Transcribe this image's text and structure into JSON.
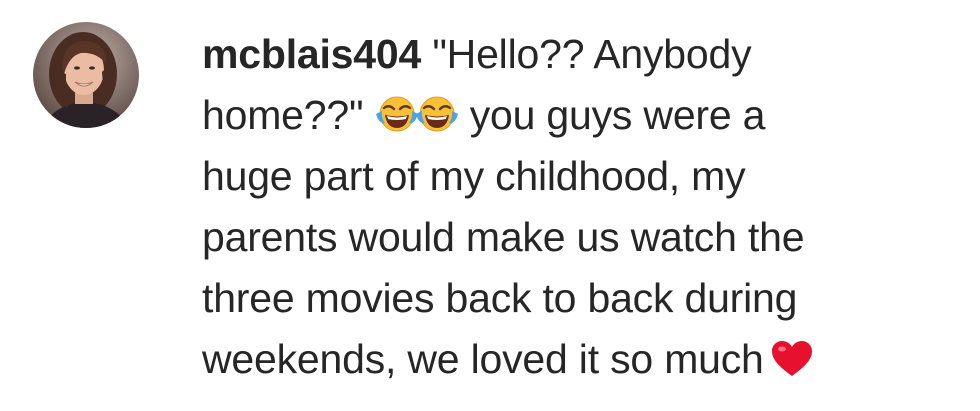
{
  "comment": {
    "username": "mcblais404",
    "avatar_icon": "user-avatar-photo",
    "lines": {
      "l1": "\"Hello?? Anybody",
      "l2a": "home??\"",
      "l2b": "you guys were a",
      "l3": "huge part of my childhood, my",
      "l4": "parents would make us watch the",
      "l5": "three movies back to back during",
      "l6": "weekends, we loved it so much"
    },
    "emojis": [
      "face-with-tears-of-joy-icon",
      "face-with-tears-of-joy-icon",
      "red-heart-icon"
    ]
  },
  "colors": {
    "text": "#262626",
    "background": "#ffffff",
    "emoji_yellow": "#f7c037",
    "heart_red": "#e8112d"
  }
}
